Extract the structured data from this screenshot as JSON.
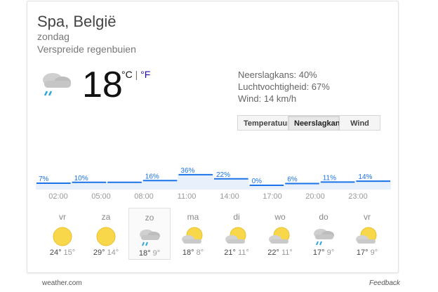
{
  "location": "Spa, België",
  "day": "zondag",
  "condition": "Verspreide regenbuien",
  "current": {
    "temp": "18",
    "unit_c": "°C",
    "sep": "|",
    "unit_f": "°F"
  },
  "details": {
    "precip": "Neerslagkans: 40%",
    "humidity": "Luchtvochtigheid: 67%",
    "wind": "Wind: 14 km/h"
  },
  "tabs": {
    "temp": "Temperatuur",
    "precip": "Neerslagkans",
    "wind": "Wind",
    "active": "precip"
  },
  "hours": [
    "02:00",
    "05:00",
    "08:00",
    "11:00",
    "14:00",
    "17:00",
    "20:00",
    "23:00"
  ],
  "chart_data": {
    "type": "area",
    "series": [
      {
        "values": [
          7,
          10,
          10,
          16,
          36,
          22,
          0,
          6,
          11,
          14
        ]
      }
    ],
    "labels": [
      "7%",
      "10%",
      "16%",
      "36%",
      "22%",
      "0%",
      "6%",
      "11%",
      "14%"
    ],
    "ylim": [
      0,
      100
    ]
  },
  "forecast": [
    {
      "name": "vr",
      "high": "24°",
      "low": "15°",
      "icon": "sun"
    },
    {
      "name": "za",
      "high": "29°",
      "low": "14°",
      "icon": "sun"
    },
    {
      "name": "zo",
      "high": "18°",
      "low": "9°",
      "icon": "rain"
    },
    {
      "name": "ma",
      "high": "18°",
      "low": "8°",
      "icon": "partly-cloudy"
    },
    {
      "name": "di",
      "high": "21°",
      "low": "11°",
      "icon": "partly-cloudy"
    },
    {
      "name": "wo",
      "high": "22°",
      "low": "11°",
      "icon": "partly-cloudy"
    },
    {
      "name": "do",
      "high": "17°",
      "low": "9°",
      "icon": "rain"
    },
    {
      "name": "vr",
      "high": "17°",
      "low": "9°",
      "icon": "partly-cloudy"
    }
  ],
  "footer": {
    "source": "weather.com",
    "feedback": "Feedback"
  },
  "colors": {
    "accent": "#1a73e8",
    "chart_fill": "#e8f1fb",
    "sun": "#f8d74a"
  }
}
